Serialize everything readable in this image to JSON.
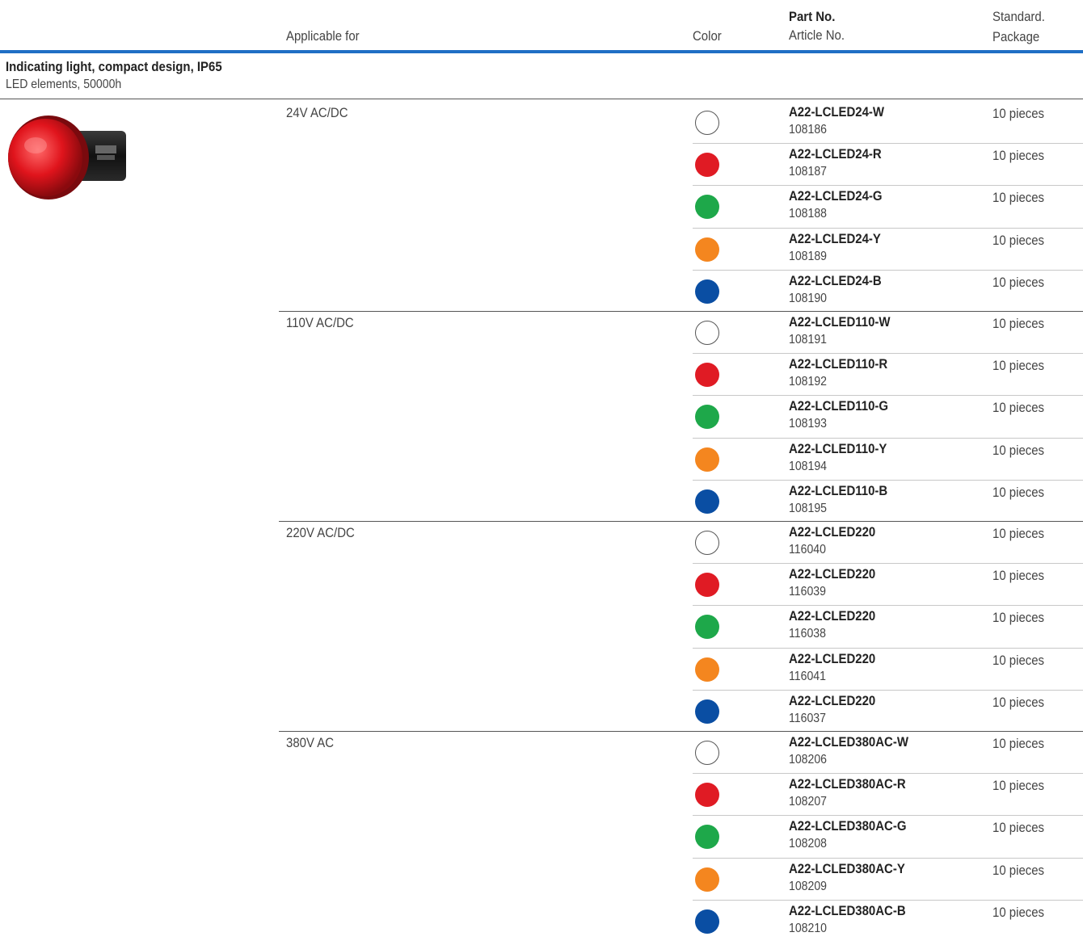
{
  "header": {
    "applicable_for": "Applicable for",
    "color": "Color",
    "part_no": "Part No.",
    "article_no": "Article No.",
    "standard": "Standard.",
    "package": "Package"
  },
  "section": {
    "title": "Indicating light, compact design, IP65",
    "subtitle": "LED elements, 50000h"
  },
  "colors": {
    "W": "#ffffff",
    "R": "#e01b24",
    "G": "#1ea84a",
    "Y": "#f4861f",
    "B": "#0a4ea3",
    "accent_rule": "#1f6fc5"
  },
  "groups": [
    {
      "voltage": "24V AC/DC",
      "rows": [
        {
          "color": "W",
          "part": "A22-LCLED24-W",
          "article": "108186",
          "package": "10 pieces"
        },
        {
          "color": "R",
          "part": "A22-LCLED24-R",
          "article": "108187",
          "package": "10 pieces"
        },
        {
          "color": "G",
          "part": "A22-LCLED24-G",
          "article": "108188",
          "package": "10 pieces"
        },
        {
          "color": "Y",
          "part": "A22-LCLED24-Y",
          "article": "108189",
          "package": "10 pieces"
        },
        {
          "color": "B",
          "part": "A22-LCLED24-B",
          "article": "108190",
          "package": "10 pieces"
        }
      ]
    },
    {
      "voltage": "110V AC/DC",
      "rows": [
        {
          "color": "W",
          "part": "A22-LCLED110-W",
          "article": "108191",
          "package": "10 pieces"
        },
        {
          "color": "R",
          "part": "A22-LCLED110-R",
          "article": "108192",
          "package": "10 pieces"
        },
        {
          "color": "G",
          "part": "A22-LCLED110-G",
          "article": "108193",
          "package": "10 pieces"
        },
        {
          "color": "Y",
          "part": "A22-LCLED110-Y",
          "article": "108194",
          "package": "10 pieces"
        },
        {
          "color": "B",
          "part": "A22-LCLED110-B",
          "article": "108195",
          "package": "10 pieces"
        }
      ]
    },
    {
      "voltage": "220V AC/DC",
      "rows": [
        {
          "color": "W",
          "part": "A22-LCLED220",
          "article": "116040",
          "package": "10 pieces"
        },
        {
          "color": "R",
          "part": "A22-LCLED220",
          "article": "116039",
          "package": "10 pieces"
        },
        {
          "color": "G",
          "part": "A22-LCLED220",
          "article": "116038",
          "package": "10 pieces"
        },
        {
          "color": "Y",
          "part": "A22-LCLED220",
          "article": "116041",
          "package": "10 pieces"
        },
        {
          "color": "B",
          "part": "A22-LCLED220",
          "article": "116037",
          "package": "10 pieces"
        }
      ]
    },
    {
      "voltage": "380V AC",
      "rows": [
        {
          "color": "W",
          "part": "A22-LCLED380AC-W",
          "article": "108206",
          "package": "10 pieces"
        },
        {
          "color": "R",
          "part": "A22-LCLED380AC-R",
          "article": "108207",
          "package": "10 pieces"
        },
        {
          "color": "G",
          "part": "A22-LCLED380AC-G",
          "article": "108208",
          "package": "10 pieces"
        },
        {
          "color": "Y",
          "part": "A22-LCLED380AC-Y",
          "article": "108209",
          "package": "10 pieces"
        },
        {
          "color": "B",
          "part": "A22-LCLED380AC-B",
          "article": "108210",
          "package": "10 pieces"
        }
      ]
    }
  ]
}
